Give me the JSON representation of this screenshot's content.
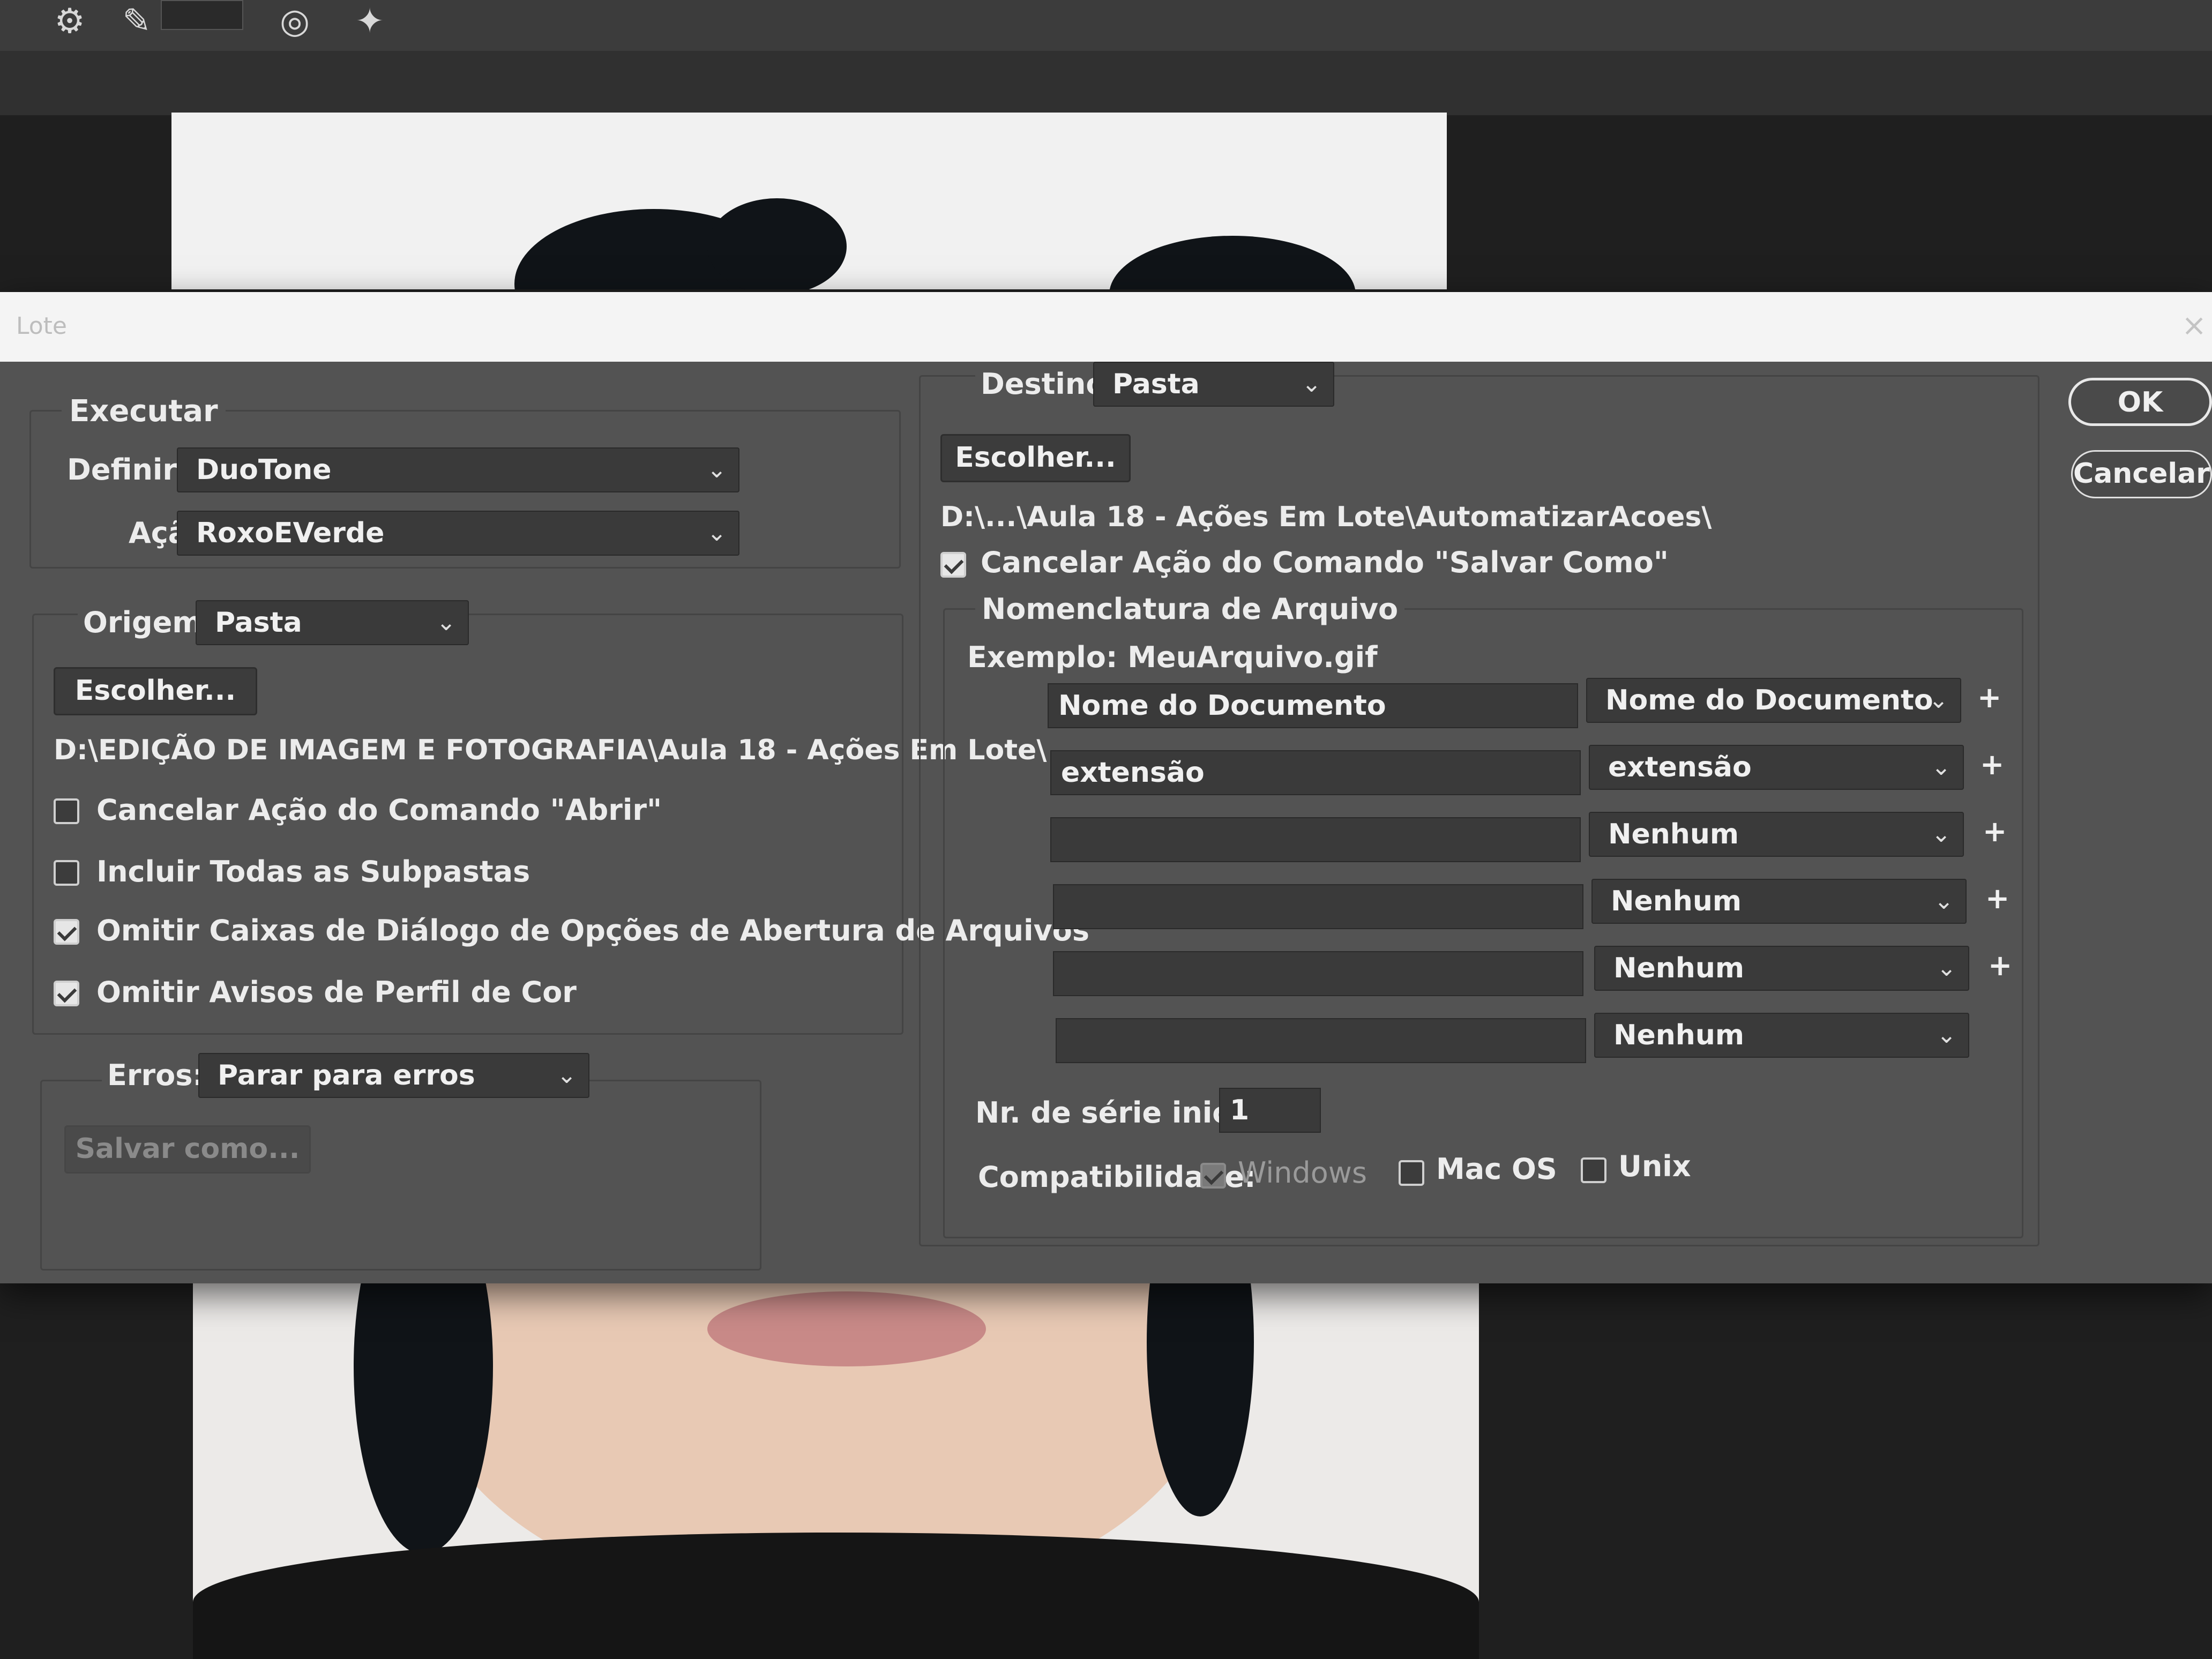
{
  "dialog": {
    "title": "Lote",
    "close_glyph": "×"
  },
  "buttons": {
    "ok": "OK",
    "cancel": "Cancelar"
  },
  "executar": {
    "legend": "Executar",
    "definir_label": "Definir:",
    "definir_value": "DuoTone",
    "acao_label": "Ação:",
    "acao_value": "RoxoEVerde"
  },
  "origem": {
    "label": "Origem:",
    "value": "Pasta",
    "choose_button": "Escolher...",
    "path": "D:\\EDIÇÃO DE IMAGEM E FOTOGRAFIA\\Aula 18 - Ações Em Lote\\",
    "options": [
      {
        "label": "Cancelar Ação do Comando \"Abrir\"",
        "checked": false
      },
      {
        "label": "Incluir Todas as Subpastas",
        "checked": false
      },
      {
        "label": "Omitir Caixas de Diálogo de Opções de Abertura de Arquivos",
        "checked": true
      },
      {
        "label": "Omitir Avisos de Perfil de Cor",
        "checked": true
      }
    ]
  },
  "erros": {
    "label": "Erros:",
    "value": "Parar para erros",
    "save_button": "Salvar como..."
  },
  "destino": {
    "label": "Destino:",
    "value": "Pasta",
    "choose_button": "Escolher...",
    "path": "D:\\...\\Aula 18 - Ações Em Lote\\AutomatizarAcoes\\",
    "override_label": "Cancelar Ação do Comando \"Salvar Como\"",
    "override_checked": true
  },
  "nomenclatura": {
    "legend": "Nomenclatura de Arquivo",
    "example": "Exemplo: MeuArquivo.gif",
    "rows": [
      {
        "text": "Nome do Documento",
        "select": "Nome do Documento",
        "plus": true
      },
      {
        "text": "extensão",
        "select": "extensão",
        "plus": true
      },
      {
        "text": "",
        "select": "Nenhum",
        "plus": true
      },
      {
        "text": "",
        "select": "Nenhum",
        "plus": true
      },
      {
        "text": "",
        "select": "Nenhum",
        "plus": true
      },
      {
        "text": "",
        "select": "Nenhum",
        "plus": false
      }
    ],
    "serial_label": "Nr. de série inicial:",
    "serial_value": "1",
    "compat_label": "Compatibilidade:",
    "compat": [
      {
        "label": "Windows",
        "checked": true,
        "disabled": true
      },
      {
        "label": "Mac OS",
        "checked": false,
        "disabled": false
      },
      {
        "label": "Unix",
        "checked": false,
        "disabled": false
      }
    ]
  },
  "icons": {
    "chevron": "⌄",
    "plus": "+"
  }
}
